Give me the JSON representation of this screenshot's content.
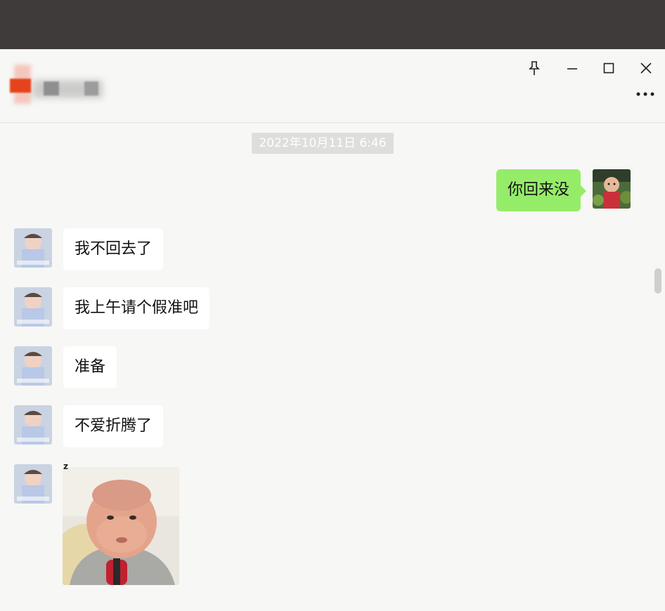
{
  "window": {
    "contact_name": "",
    "controls": {
      "pin_icon": "pin-icon",
      "minimize_icon": "minimize-icon",
      "maximize_icon": "maximize-icon",
      "close_icon": "close-icon",
      "more_icon": "more-icon"
    }
  },
  "chat": {
    "timestamp": "2022年10月11日 6:46",
    "messages": [
      {
        "from": "me",
        "text": "你回来没"
      },
      {
        "from": "contact",
        "text": "我不回去了"
      },
      {
        "from": "contact",
        "text": "我上午请个假准吧"
      },
      {
        "from": "contact",
        "text": "准备"
      },
      {
        "from": "contact",
        "text": "不爱折腾了"
      },
      {
        "from": "contact",
        "type": "sticker",
        "sticker_mark": "z"
      }
    ]
  },
  "colors": {
    "window_bg": "#f7f7f5",
    "outer_bg": "#3d3a39",
    "my_bubble": "#95ec69",
    "their_bubble": "#ffffff",
    "timestamp_bg": "#dededc"
  }
}
